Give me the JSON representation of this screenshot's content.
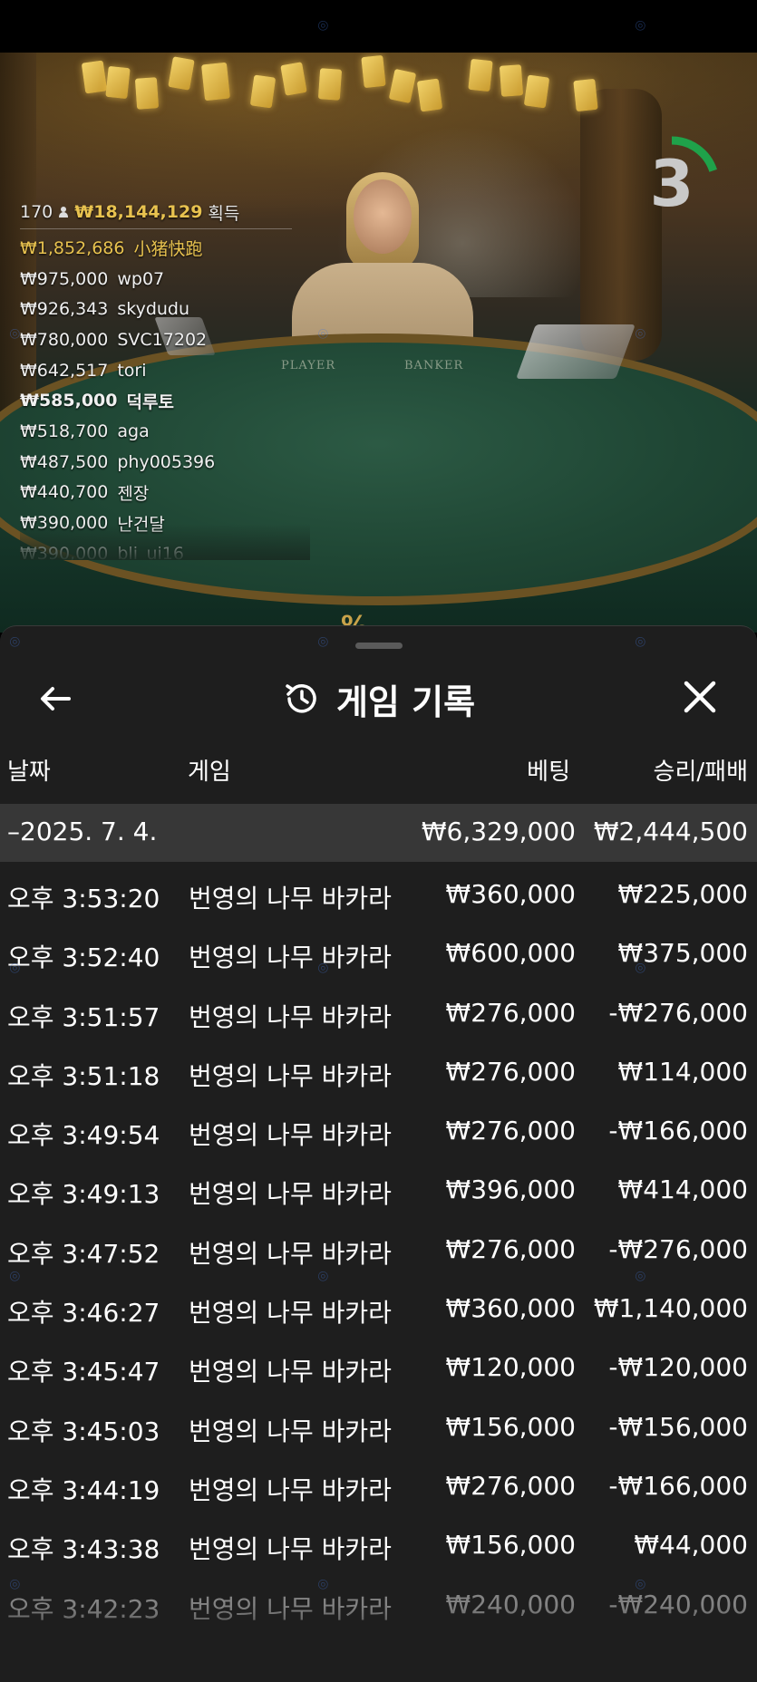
{
  "timer": {
    "value": "3",
    "progress": 0.2
  },
  "winners": {
    "count": "170",
    "total": "₩18,144,129",
    "earn_label": "획득",
    "list": [
      {
        "amount": "₩1,852,686",
        "name": "小猪快跑"
      },
      {
        "amount": "₩975,000",
        "name": "wp07"
      },
      {
        "amount": "₩926,343",
        "name": "skydudu"
      },
      {
        "amount": "₩780,000",
        "name": "SVC17202"
      },
      {
        "amount": "₩642,517",
        "name": "tori"
      },
      {
        "amount": "₩585,000",
        "name": "덕루토"
      },
      {
        "amount": "₩518,700",
        "name": "aga"
      },
      {
        "amount": "₩487,500",
        "name": "phy005396"
      },
      {
        "amount": "₩440,700",
        "name": "젠장"
      },
      {
        "amount": "₩390,000",
        "name": "난건달"
      },
      {
        "amount": "₩390,000",
        "name": "bli_ui16"
      }
    ]
  },
  "table": {
    "player_label": "PLAYER",
    "banker_label": "BANKER"
  },
  "sheet": {
    "title": "게임 기록",
    "columns": {
      "date": "날짜",
      "game": "게임",
      "bet": "베팅",
      "result": "승리/패배"
    },
    "summary": {
      "date": "–2025. 7. 4.",
      "bet": "₩6,329,000",
      "result": "₩2,444,500"
    },
    "rows": [
      {
        "time": "오후 3:53:20",
        "game": "번영의 나무 바카라",
        "bet": "₩360,000",
        "result": "₩225,000"
      },
      {
        "time": "오후 3:52:40",
        "game": "번영의 나무 바카라",
        "bet": "₩600,000",
        "result": "₩375,000"
      },
      {
        "time": "오후 3:51:57",
        "game": "번영의 나무 바카라",
        "bet": "₩276,000",
        "result": "-₩276,000"
      },
      {
        "time": "오후 3:51:18",
        "game": "번영의 나무 바카라",
        "bet": "₩276,000",
        "result": "₩114,000"
      },
      {
        "time": "오후 3:49:54",
        "game": "번영의 나무 바카라",
        "bet": "₩276,000",
        "result": "-₩166,000"
      },
      {
        "time": "오후 3:49:13",
        "game": "번영의 나무 바카라",
        "bet": "₩396,000",
        "result": "₩414,000"
      },
      {
        "time": "오후 3:47:52",
        "game": "번영의 나무 바카라",
        "bet": "₩276,000",
        "result": "-₩276,000"
      },
      {
        "time": "오후 3:46:27",
        "game": "번영의 나무 바카라",
        "bet": "₩360,000",
        "result": "₩1,140,000"
      },
      {
        "time": "오후 3:45:47",
        "game": "번영의 나무 바카라",
        "bet": "₩120,000",
        "result": "-₩120,000"
      },
      {
        "time": "오후 3:45:03",
        "game": "번영의 나무 바카라",
        "bet": "₩156,000",
        "result": "-₩156,000"
      },
      {
        "time": "오후 3:44:19",
        "game": "번영의 나무 바카라",
        "bet": "₩276,000",
        "result": "-₩166,000"
      },
      {
        "time": "오후 3:43:38",
        "game": "번영의 나무 바카라",
        "bet": "₩156,000",
        "result": "₩44,000"
      },
      {
        "time": "오후 3:42:23",
        "game": "번영의 나무 바카라",
        "bet": "₩240,000",
        "result": "-₩240,000"
      }
    ]
  },
  "colors": {
    "accent_gold": "#e8c24f",
    "timer_green": "#1fa24a",
    "sheet_bg": "#1e1e1e",
    "summary_bg": "#373737"
  }
}
